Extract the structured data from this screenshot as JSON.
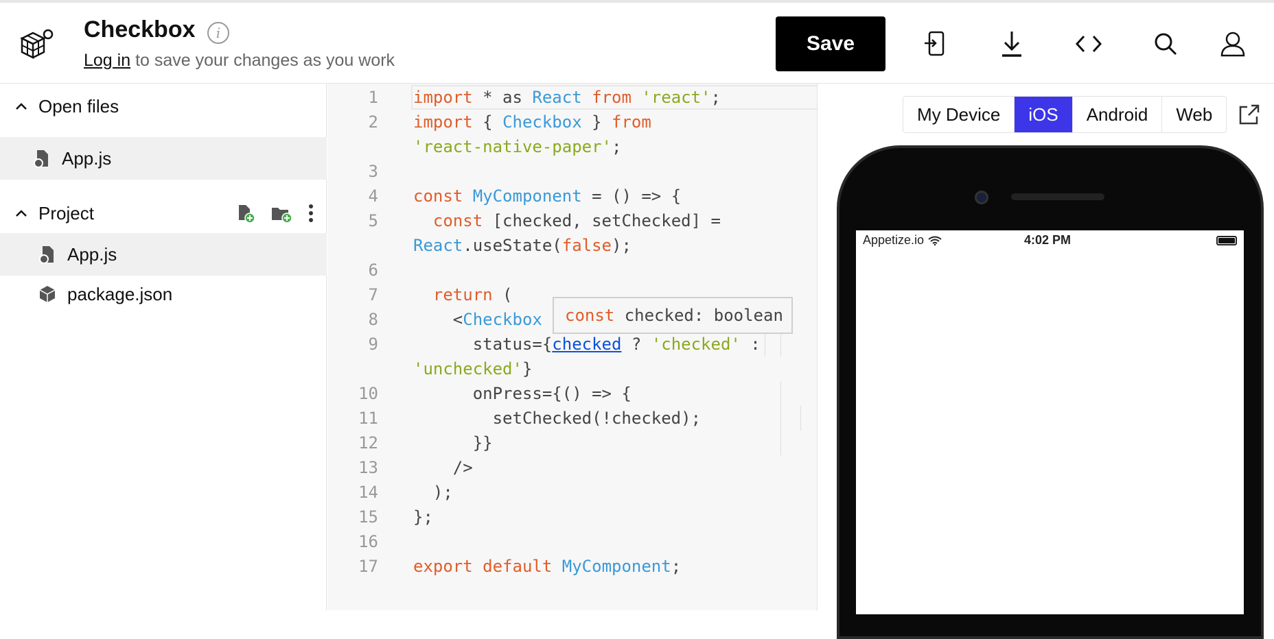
{
  "header": {
    "title": "Checkbox",
    "login_link": "Log in",
    "login_suffix": " to save your changes as you work",
    "save_label": "Save"
  },
  "sidebar": {
    "open_files_label": "Open files",
    "open_files": [
      {
        "name": "App.js"
      }
    ],
    "project_label": "Project",
    "project_files": [
      {
        "name": "App.js"
      },
      {
        "name": "package.json"
      }
    ]
  },
  "editor": {
    "line_numbers": [
      "1",
      "2",
      "",
      "3",
      "4",
      "5",
      "",
      "6",
      "7",
      "8",
      "9",
      "",
      "10",
      "11",
      "12",
      "13",
      "14",
      "15",
      "16",
      "17"
    ],
    "tooltip": {
      "keyword": "const",
      "text": " checked: boolean"
    }
  },
  "preview": {
    "tabs": [
      "My Device",
      "iOS",
      "Android",
      "Web"
    ],
    "active_tab": "iOS",
    "status_bar": {
      "carrier": "Appetize.io",
      "time": "4:02 PM"
    }
  },
  "colors": {
    "keyword": "#e05d2a",
    "type": "#3a99d8",
    "string": "#8aaa1e",
    "accent": "#3d36e8",
    "link": "#0a52d6"
  }
}
